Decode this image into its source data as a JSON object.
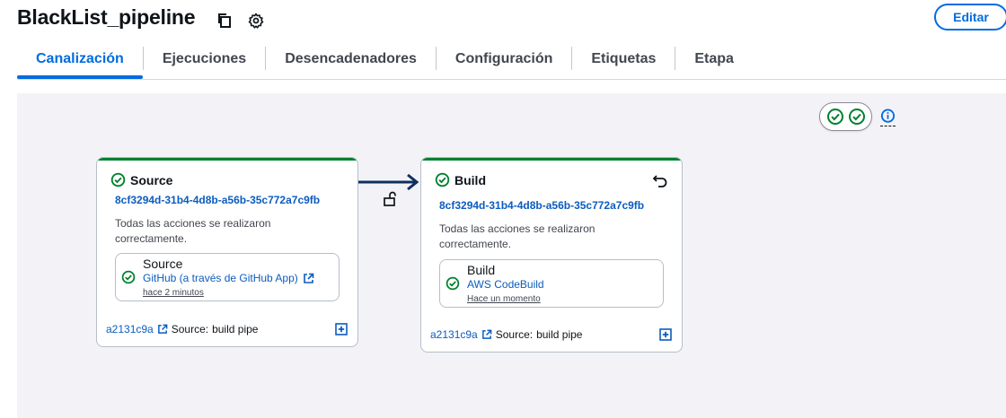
{
  "header": {
    "title": "BlackList_pipeline",
    "edit_label": "Editar"
  },
  "tabs": [
    {
      "label": "Canalización",
      "active": true
    },
    {
      "label": "Ejecuciones",
      "active": false
    },
    {
      "label": "Desencadenadores",
      "active": false
    },
    {
      "label": "Configuración",
      "active": false
    },
    {
      "label": "Etiquetas",
      "active": false
    },
    {
      "label": "Etapa",
      "active": false
    }
  ],
  "colors": {
    "accent": "#006ce0",
    "success": "#00802f",
    "link": "#0b5cbf"
  },
  "stages": [
    {
      "name": "Source",
      "execution_id": "8cf3294d-31b4-4d8b-a56b-35c772a7c9fb",
      "status_text": "Todas las acciones se realizaron correctamente.",
      "action": {
        "name": "Source",
        "provider": "GitHub (a través de GitHub App)",
        "time": "hace 2 minutos",
        "external_link_icon": "external-link-icon"
      },
      "footer": {
        "commit": "a2131c9a",
        "source_label": "Source:",
        "message": "build pipe"
      }
    },
    {
      "name": "Build",
      "execution_id": "8cf3294d-31b4-4d8b-a56b-35c772a7c9fb",
      "status_text": "Todas las acciones se realizaron correctamente.",
      "action": {
        "name": "Build",
        "provider": "AWS CodeBuild",
        "time": "Hace un momento"
      },
      "footer": {
        "commit": "a2131c9a",
        "source_label": "Source:",
        "message": "build pipe"
      }
    }
  ]
}
